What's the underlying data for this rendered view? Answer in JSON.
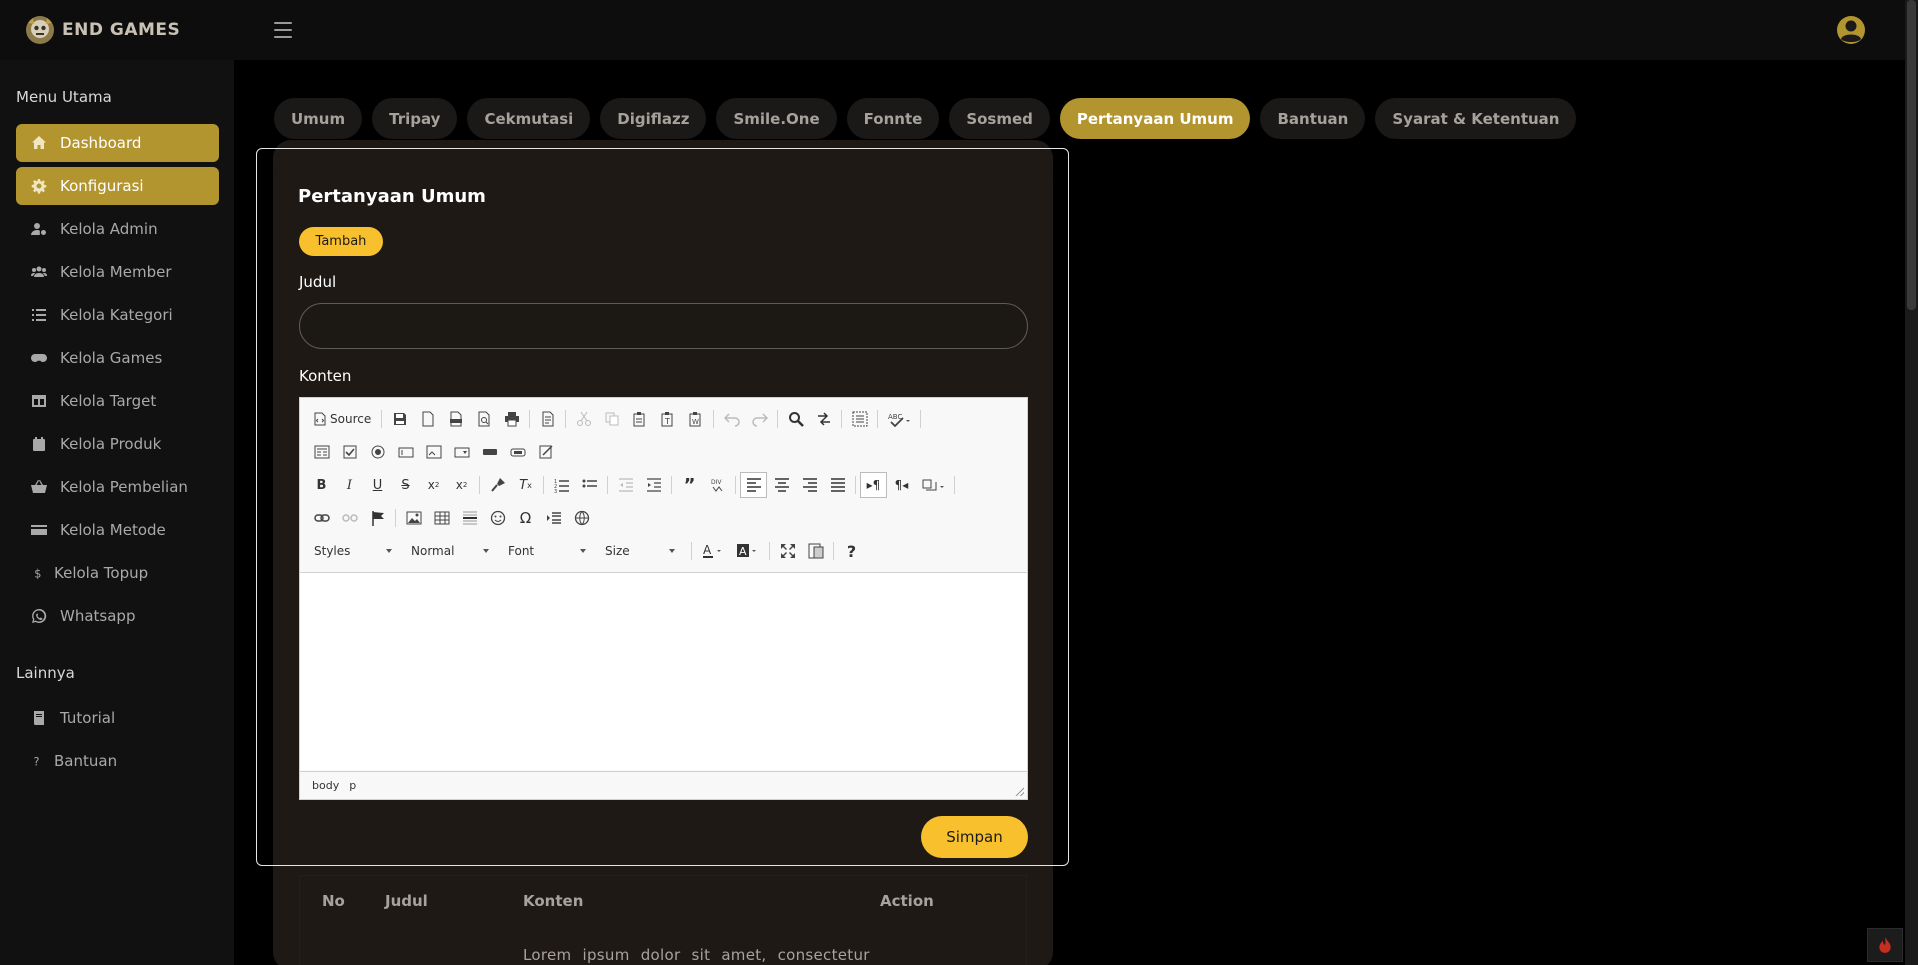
{
  "app": {
    "brand_name": "END GAMES"
  },
  "sidebar": {
    "menu_title": "Menu Utama",
    "items": [
      {
        "label": "Dashboard",
        "icon": "home-icon",
        "active": true
      },
      {
        "label": "Konfigurasi",
        "icon": "gear-icon",
        "active": true
      },
      {
        "label": "Kelola Admin",
        "icon": "user-gear-icon"
      },
      {
        "label": "Kelola Member",
        "icon": "users-icon"
      },
      {
        "label": "Kelola Kategori",
        "icon": "list-icon"
      },
      {
        "label": "Kelola Games",
        "icon": "gamepad-icon"
      },
      {
        "label": "Kelola Target",
        "icon": "table-icon"
      },
      {
        "label": "Kelola Produk",
        "icon": "calendar-icon"
      },
      {
        "label": "Kelola Pembelian",
        "icon": "basket-icon"
      },
      {
        "label": "Kelola Metode",
        "icon": "credit-card-icon"
      },
      {
        "label": "Kelola Topup",
        "icon": "dollar-icon"
      },
      {
        "label": "Whatsapp",
        "icon": "whatsapp-icon"
      }
    ],
    "other_title": "Lainnya",
    "other_items": [
      {
        "label": "Tutorial",
        "icon": "book-icon"
      },
      {
        "label": "Bantuan",
        "icon": "question-icon"
      }
    ]
  },
  "tabs": [
    {
      "label": "Umum"
    },
    {
      "label": "Tripay"
    },
    {
      "label": "Cekmutasi"
    },
    {
      "label": "Digiflazz"
    },
    {
      "label": "Smile.One"
    },
    {
      "label": "Fonnte"
    },
    {
      "label": "Sosmed"
    },
    {
      "label": "Pertanyaan Umum",
      "active": true
    },
    {
      "label": "Bantuan"
    },
    {
      "label": "Syarat & Ketentuan"
    }
  ],
  "modal": {
    "title": "Pertanyaan Umum",
    "add_button": "Tambah",
    "judul_label": "Judul",
    "judul_value": "",
    "konten_label": "Konten",
    "save_button": "Simpan"
  },
  "editor": {
    "source_label": "Source",
    "combos": {
      "styles": "Styles",
      "format": "Normal",
      "font": "Font",
      "size": "Size"
    },
    "status_path": [
      "body",
      "p"
    ],
    "help_label": "?"
  },
  "table": {
    "headers": {
      "no": "No",
      "judul": "Judul",
      "konten": "Konten",
      "action": "Action"
    },
    "first_row_konten": "Lorem ipsum dolor sit amet, consectetur"
  },
  "colors": {
    "accent": "#f8c02d",
    "active_nav": "#b39530",
    "card_bg": "#1e1915",
    "sidebar_bg": "#111111"
  }
}
